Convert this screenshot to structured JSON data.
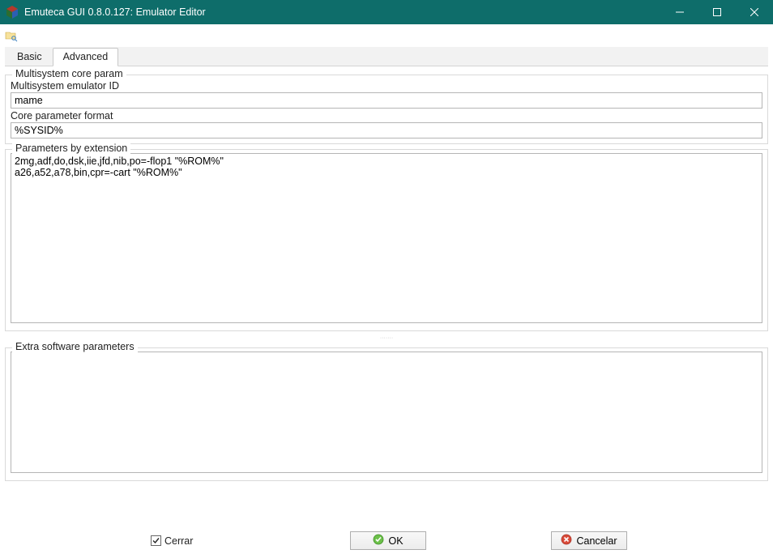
{
  "window_title": "Emuteca GUI 0.8.0.127: Emulator Editor",
  "tabs": {
    "basic": "Basic",
    "advanced": "Advanced",
    "active": "advanced"
  },
  "multisystem": {
    "legend": "Multisystem core param",
    "id_label": "Multisystem emulator ID",
    "id_value": "mame",
    "fmt_label": "Core parameter format",
    "fmt_value": "%SYSID%"
  },
  "params_ext": {
    "legend": "Parameters by extension",
    "value": "2mg,adf,do,dsk,iie,jfd,nib,po=-flop1 \"%ROM%\"\na26,a52,a78,bin,cpr=-cart \"%ROM%\""
  },
  "extra_params": {
    "legend": "Extra software parameters",
    "value": ""
  },
  "footer": {
    "close_label": "Cerrar",
    "close_checked": true,
    "ok_label": "OK",
    "cancel_label": "Cancelar"
  }
}
